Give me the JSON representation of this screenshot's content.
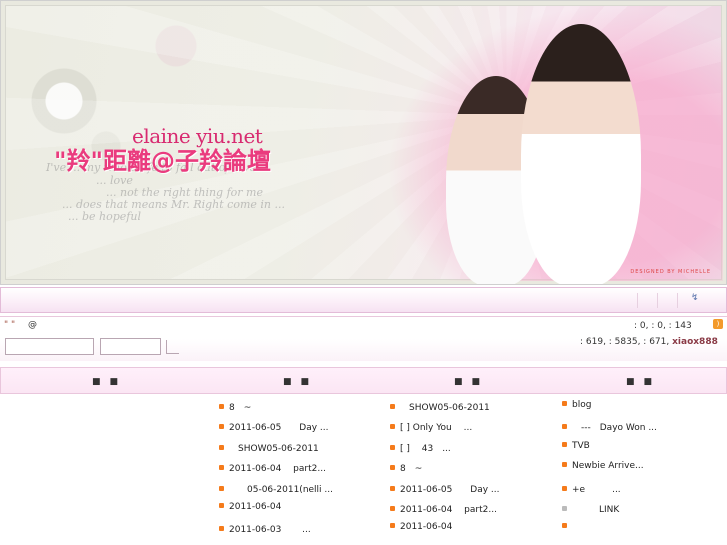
{
  "header": {
    "site_title": "elaine yiu.net",
    "site_subtitle": "\"羚\"距離@子羚論壇",
    "lyrics": [
      "I've ... my whole life to fall out of love",
      "... love",
      "... not the right thing for me",
      "... does that means Mr. Right come in ...",
      "... be hopeful"
    ],
    "designed_by": "DESIGNED BY MICHELLE"
  },
  "userbar": {
    "dots": "\" \"",
    "at": "@",
    "stats_line1": ": 0,   : 0,   : 143",
    "stats_line2_prefix": ": 619,   : 5835,   : 671,   ",
    "newest_member": "xiaox888"
  },
  "columns": [
    {
      "header": "■　■",
      "items": []
    },
    {
      "header": "■　■",
      "items": [
        "8　~",
        "2011-06-05　　Day ...",
        "　SHOW05-06-2011",
        "2011-06-04　 part2...",
        "　　05-06-2011(nelli ...",
        "2011-06-04",
        "2011-06-03　　 ..."
      ]
    },
    {
      "header": "■　■",
      "items": [
        "　SHOW05-06-2011",
        "[  ] Only You　 ...",
        "[  ]　 43　...",
        "8　~",
        "2011-06-05　　Day ...",
        "2011-06-04　 part2...",
        "2011-06-04"
      ]
    },
    {
      "header": "■　■",
      "items": [
        "blog",
        "　---　Dayo Won ...",
        "TVB",
        "Newbie Arrive...",
        "+e　　　...",
        "　　　LINK",
        ""
      ]
    }
  ],
  "colors": {
    "accent": "#ea3b7e",
    "bullet": "#f57b1b",
    "nav_border": "#e3bcd8"
  }
}
